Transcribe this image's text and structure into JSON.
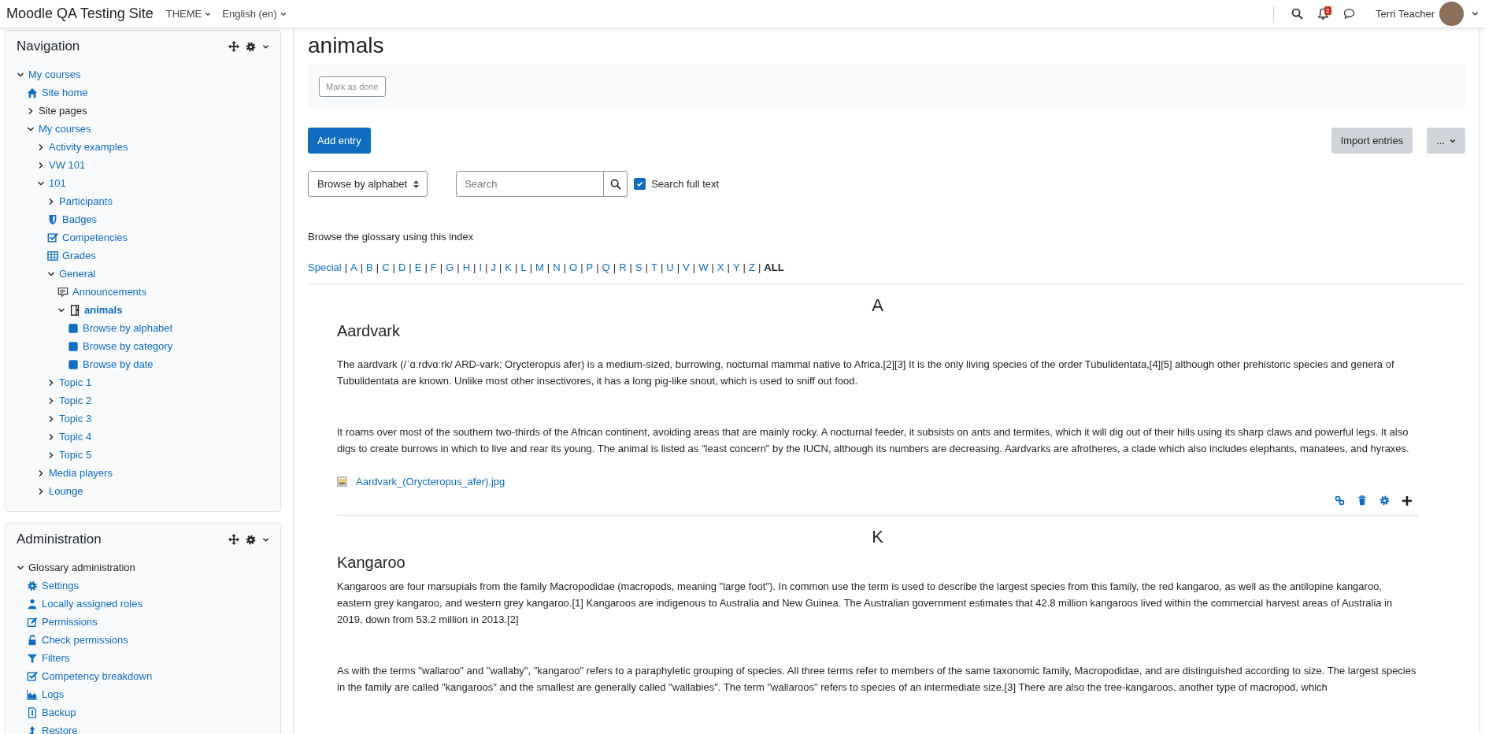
{
  "navbar": {
    "site_name": "Moodle QA Testing Site",
    "menus": [
      {
        "label": "THEME"
      },
      {
        "label": "English (en)"
      }
    ],
    "notification_count": "2",
    "user_name": "Terri Teacher"
  },
  "navigation": {
    "title": "Navigation",
    "items": [
      {
        "label": "My courses",
        "expanded": true,
        "link": true,
        "selected": false,
        "children": [
          {
            "label": "Site home",
            "kind": "home",
            "link": true,
            "selected": false
          },
          {
            "label": "Site pages",
            "expanded": false,
            "link": false,
            "selected": false
          },
          {
            "label": "My courses",
            "expanded": true,
            "link": true,
            "selected": false,
            "children": [
              {
                "label": "Activity examples",
                "expanded": false,
                "link": true,
                "selected": false
              },
              {
                "label": "VW 101",
                "expanded": false,
                "link": true,
                "selected": false
              },
              {
                "label": "101",
                "expanded": true,
                "link": true,
                "selected": false,
                "children": [
                  {
                    "label": "Participants",
                    "expanded": false,
                    "link": true,
                    "selected": false
                  },
                  {
                    "label": "Badges",
                    "kind": "badges",
                    "link": true,
                    "selected": false
                  },
                  {
                    "label": "Competencies",
                    "kind": "competencies",
                    "link": true,
                    "selected": false
                  },
                  {
                    "label": "Grades",
                    "kind": "grades",
                    "link": true,
                    "selected": false
                  },
                  {
                    "label": "General",
                    "expanded": true,
                    "link": true,
                    "selected": false,
                    "children": [
                      {
                        "label": "Announcements",
                        "kind": "forum",
                        "link": true,
                        "selected": false
                      },
                      {
                        "label": "animals",
                        "kind": "glossary",
                        "expanded": true,
                        "link": true,
                        "selected": true,
                        "children": [
                          {
                            "label": "Browse by alphabet",
                            "kind": "view",
                            "link": true,
                            "selected": false
                          },
                          {
                            "label": "Browse by category",
                            "kind": "view",
                            "link": true,
                            "selected": false
                          },
                          {
                            "label": "Browse by date",
                            "kind": "view",
                            "link": true,
                            "selected": false
                          }
                        ]
                      }
                    ]
                  },
                  {
                    "label": "Topic 1",
                    "expanded": false,
                    "link": true,
                    "selected": false
                  },
                  {
                    "label": "Topic 2",
                    "expanded": false,
                    "link": true,
                    "selected": false
                  },
                  {
                    "label": "Topic 3",
                    "expanded": false,
                    "link": true,
                    "selected": false
                  },
                  {
                    "label": "Topic 4",
                    "expanded": false,
                    "link": true,
                    "selected": false
                  },
                  {
                    "label": "Topic 5",
                    "expanded": false,
                    "link": true,
                    "selected": false
                  }
                ]
              },
              {
                "label": "Media players",
                "expanded": false,
                "link": true,
                "selected": false
              },
              {
                "label": "Lounge",
                "expanded": false,
                "link": true,
                "selected": false
              }
            ]
          }
        ]
      }
    ]
  },
  "administration": {
    "title": "Administration",
    "items": [
      {
        "label": "Glossary administration",
        "expanded": true,
        "link": false,
        "selected": false,
        "children": [
          {
            "label": "Settings",
            "kind": "settings",
            "link": true,
            "selected": false
          },
          {
            "label": "Locally assigned roles",
            "kind": "roles",
            "link": true,
            "selected": false
          },
          {
            "label": "Permissions",
            "kind": "permissions",
            "link": true,
            "selected": false
          },
          {
            "label": "Check permissions",
            "kind": "check-permissions",
            "link": true,
            "selected": false
          },
          {
            "label": "Filters",
            "kind": "filters",
            "link": true,
            "selected": false
          },
          {
            "label": "Competency breakdown",
            "kind": "competencies",
            "link": true,
            "selected": false
          },
          {
            "label": "Logs",
            "kind": "logs",
            "link": true,
            "selected": false
          },
          {
            "label": "Backup",
            "kind": "backup",
            "link": true,
            "selected": false
          },
          {
            "label": "Restore",
            "kind": "restore",
            "link": true,
            "selected": false
          }
        ]
      }
    ]
  },
  "page": {
    "title": "animals",
    "mark_done": "Mark as done",
    "add_entry": "Add entry",
    "import_entries": "Import entries",
    "more": "...",
    "browse_select": "Browse by alphabet",
    "search": {
      "placeholder": "Search"
    },
    "search_full_text": {
      "label": "Search full text",
      "checked": true
    },
    "index_intro": "Browse the glossary using this index",
    "index_separator": "|",
    "index": [
      {
        "label": "Special",
        "selected": false
      },
      {
        "label": "A",
        "selected": false
      },
      {
        "label": "B",
        "selected": false
      },
      {
        "label": "C",
        "selected": false
      },
      {
        "label": "D",
        "selected": false
      },
      {
        "label": "E",
        "selected": false
      },
      {
        "label": "F",
        "selected": false
      },
      {
        "label": "G",
        "selected": false
      },
      {
        "label": "H",
        "selected": false
      },
      {
        "label": "I",
        "selected": false
      },
      {
        "label": "J",
        "selected": false
      },
      {
        "label": "K",
        "selected": false
      },
      {
        "label": "L",
        "selected": false
      },
      {
        "label": "M",
        "selected": false
      },
      {
        "label": "N",
        "selected": false
      },
      {
        "label": "O",
        "selected": false
      },
      {
        "label": "P",
        "selected": false
      },
      {
        "label": "Q",
        "selected": false
      },
      {
        "label": "R",
        "selected": false
      },
      {
        "label": "S",
        "selected": false
      },
      {
        "label": "T",
        "selected": false
      },
      {
        "label": "U",
        "selected": false
      },
      {
        "label": "V",
        "selected": false
      },
      {
        "label": "W",
        "selected": false
      },
      {
        "label": "X",
        "selected": false
      },
      {
        "label": "Y",
        "selected": false
      },
      {
        "label": "Z",
        "selected": false
      },
      {
        "label": "ALL",
        "selected": true
      }
    ],
    "entries": [
      {
        "letter": "A",
        "term": "Aardvark",
        "paragraphs": [
          "The aardvark (/ˈɑːrdvɑːrk/ ARD-vark; Orycteropus afer) is a medium-sized, burrowing, nocturnal mammal native to Africa.[2][3] It is the only living species of the order Tubulidentata,[4][5] although other prehistoric species and genera of Tubulidentata are known. Unlike most other insectivores, it has a long pig-like snout, which is used to sniff out food.",
          "It roams over most of the southern two-thirds of the African continent, avoiding areas that are mainly rocky. A nocturnal feeder, it subsists on ants and termites, which it will dig out of their hills using its sharp claws and powerful legs. It also digs to create burrows in which to live and rear its young. The animal is listed as \"least concern\" by the IUCN, although its numbers are decreasing. Aardvarks are afrotheres, a clade which also includes elephants, manatees, and hyraxes."
        ],
        "attachment": "Aardvark_(Orycteropus_afer).jpg",
        "actions": true
      },
      {
        "letter": "K",
        "term": "Kangaroo",
        "paragraphs": [
          "Kangaroos are four marsupials from the family Macropodidae (macropods, meaning \"large foot\"). In common use the term is used to describe the largest species from this family, the red kangaroo, as well as the antilopine kangaroo, eastern grey kangaroo, and western grey kangaroo.[1] Kangaroos are indigenous to Australia and New Guinea. The Australian government estimates that 42.8 million kangaroos lived within the commercial harvest areas of Australia in 2019, down from 53.2 million in 2013.[2]",
          "As with the terms \"wallaroo\" and \"wallaby\", \"kangaroo\" refers to a paraphyletic grouping of species. All three terms refer to members of the same taxonomic family, Macropodidae, and are distinguished according to size. The largest species in the family are called \"kangaroos\" and the smallest are generally called \"wallabies\". The term \"wallaroos\" refers to species of an intermediate size.[3] There are also the tree-kangaroos, another type of macropod, which"
        ],
        "actions": false
      }
    ]
  }
}
